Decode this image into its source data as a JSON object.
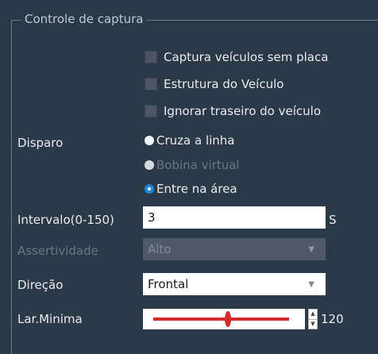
{
  "group": {
    "title": "Controle de captura"
  },
  "checkboxes": [
    {
      "label": "Captura veículos sem placa",
      "checked": false
    },
    {
      "label": "Estrutura do Veículo",
      "checked": false
    },
    {
      "label": "Ignorar traseiro do veículo",
      "checked": false
    }
  ],
  "trigger": {
    "label": "Disparo",
    "options": [
      {
        "label": "Cruza a linha",
        "selected": false,
        "enabled": true
      },
      {
        "label": "Bobina virtual",
        "selected": false,
        "enabled": false
      },
      {
        "label": "Entre na área",
        "selected": true,
        "enabled": true
      }
    ]
  },
  "interval": {
    "label": "Intervalo(0-150)",
    "value": "3",
    "unit": "S"
  },
  "confidence": {
    "label": "Assertividade",
    "value": "Alto",
    "enabled": false
  },
  "direction": {
    "label": "Direção",
    "value": "Frontal"
  },
  "min_width": {
    "label": "Lar.Minima",
    "value": "120",
    "slider_fraction": 0.55
  },
  "icons": {
    "spin_up": "spin-up-icon",
    "spin_down": "spin-down-icon",
    "dropdown": "chevron-down-icon"
  },
  "colors": {
    "background": "#2c3a48",
    "slider": "#d42a2a",
    "radio_selected": "#1c86d6"
  }
}
